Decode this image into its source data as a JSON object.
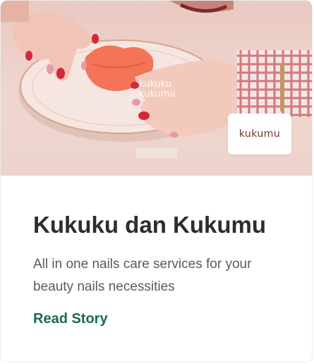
{
  "card": {
    "image_alt": "Kukuku dan Kukumu nail care",
    "plate_text_top": "kukuku",
    "plate_text_bottom": "kukumu",
    "logo_text": "kukumu",
    "title": "Kukuku dan Kukumu",
    "description": "All in one nails care services for your beauty nails necessities",
    "cta_label": "Read Story",
    "colors": {
      "title": "#2d2d2d",
      "description": "#5b5b5b",
      "cta": "#1b6a4b",
      "background": "#efd6cf"
    }
  }
}
